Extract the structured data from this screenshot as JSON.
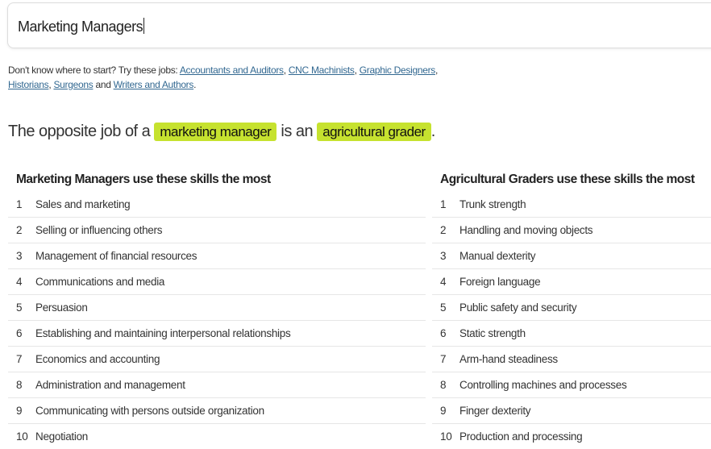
{
  "search": {
    "value": "Marketing Managers"
  },
  "hint": {
    "prefix": "Don't know where to start? Try these jobs: ",
    "links": [
      "Accountants and Auditors",
      "CNC Machinists",
      "Graphic Designers",
      "Historians",
      "Surgeons",
      "Writers and Authors"
    ],
    "sep1": ", ",
    "sep2": ", ",
    "sep3": ", ",
    "sep4": ", ",
    "and": " and ",
    "end": "."
  },
  "headline": {
    "prefix": "The opposite job of a ",
    "job": "marketing manager",
    "middle": " is an ",
    "opposite": "agricultural grader",
    "end": "."
  },
  "highlight_color": "#c6e22f",
  "left": {
    "title": "Marketing Managers use these skills the most",
    "items": [
      "Sales and marketing",
      "Selling or influencing others",
      "Management of financial resources",
      "Communications and media",
      "Persuasion",
      "Establishing and maintaining interpersonal relationships",
      "Economics and accounting",
      "Administration and management",
      "Communicating with persons outside organization",
      "Negotiation"
    ]
  },
  "right": {
    "title": "Agricultural Graders use these skills the most",
    "items": [
      "Trunk strength",
      "Handling and moving objects",
      "Manual dexterity",
      "Foreign language",
      "Public safety and security",
      "Static strength",
      "Arm-hand steadiness",
      "Controlling machines and processes",
      "Finger dexterity",
      "Production and processing"
    ]
  }
}
